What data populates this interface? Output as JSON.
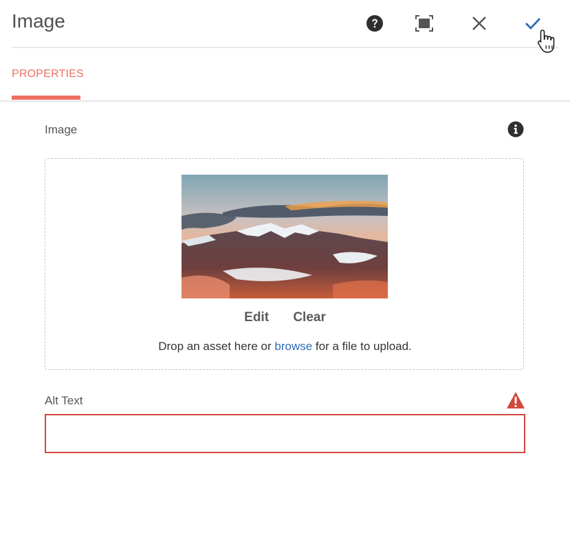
{
  "header": {
    "title": "Image",
    "icons": {
      "help": "help-icon",
      "fullscreen": "fullscreen-icon",
      "close": "close-icon",
      "confirm": "checkmark-icon"
    },
    "confirm_color": "#2d6db5"
  },
  "tabs": [
    {
      "label": "PROPERTIES",
      "active": true
    }
  ],
  "accent_color": "#ef6f62",
  "image_field": {
    "label": "Image",
    "info_icon": "info-icon",
    "actions": {
      "edit": "Edit",
      "clear": "Clear"
    },
    "drop_text_before": "Drop an asset here or ",
    "browse_link": "browse",
    "drop_text_after": " for a file to upload."
  },
  "alt_text_field": {
    "label": "Alt Text",
    "value": "",
    "placeholder": "",
    "error_icon": "warning-icon",
    "error_color": "#d0493d"
  }
}
